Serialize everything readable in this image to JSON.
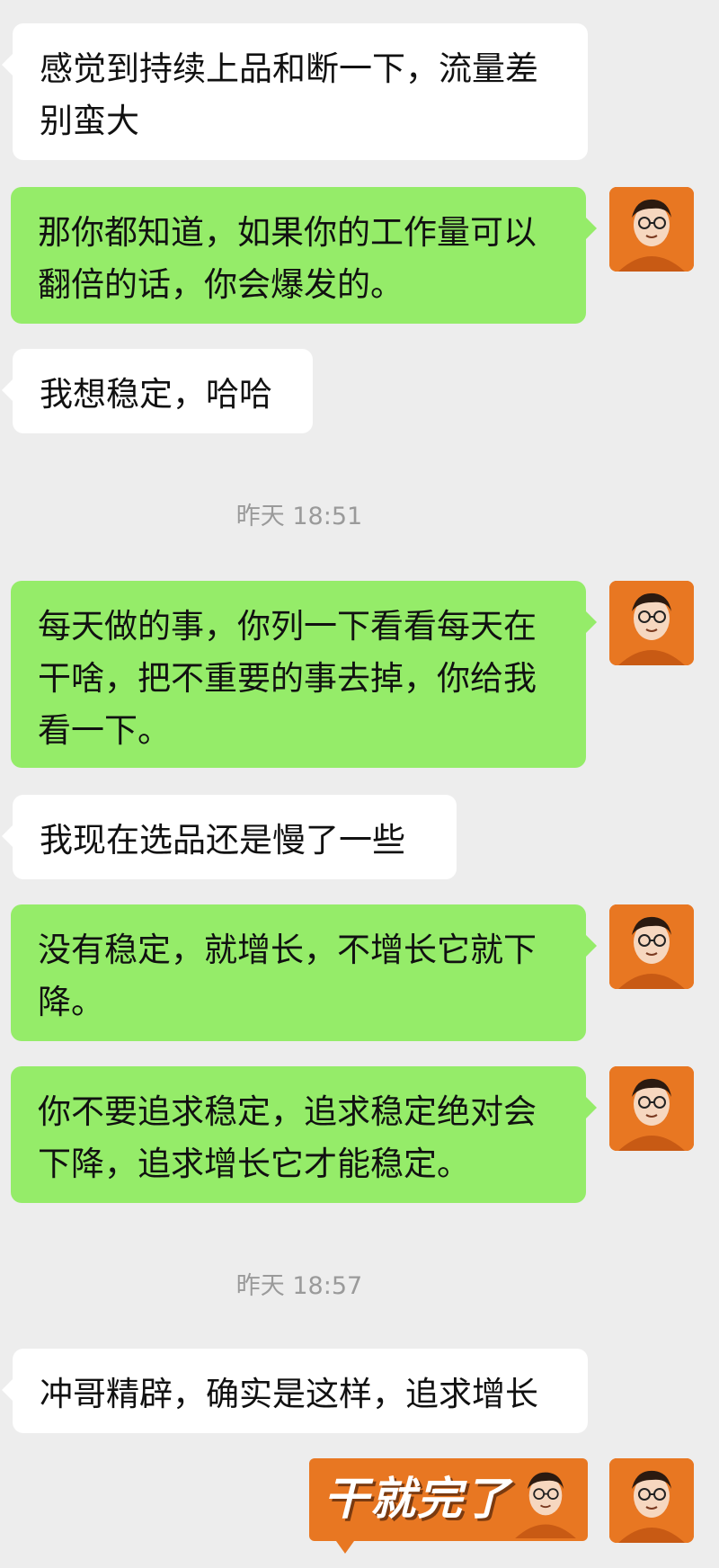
{
  "conversation": {
    "msg1": "感觉到持续上品和断一下，流量差别蛮大",
    "msg2": "那你都知道，如果你的工作量可以翻倍的话，你会爆发的。",
    "msg3": "我想稳定，哈哈",
    "time1": "昨天 18:51",
    "msg4": "每天做的事，你列一下看看每天在干啥，把不重要的事去掉，你给我看一下。",
    "msg5": "我现在选品还是慢了一些",
    "msg6": "没有稳定，就增长，不增长它就下降。",
    "msg7": "你不要追求稳定，追求稳定绝对会下降，追求增长它才能稳定。",
    "time2": "昨天 18:57",
    "msg8": "冲哥精辟，确实是这样，追求增长",
    "sticker_text": "干就完了"
  },
  "colors": {
    "background": "#ededed",
    "incoming_bubble": "#ffffff",
    "outgoing_bubble": "#95ec69",
    "avatar_bg": "#e87722"
  },
  "icons": {
    "avatar": "cartoon-man-with-glasses-avatar"
  }
}
